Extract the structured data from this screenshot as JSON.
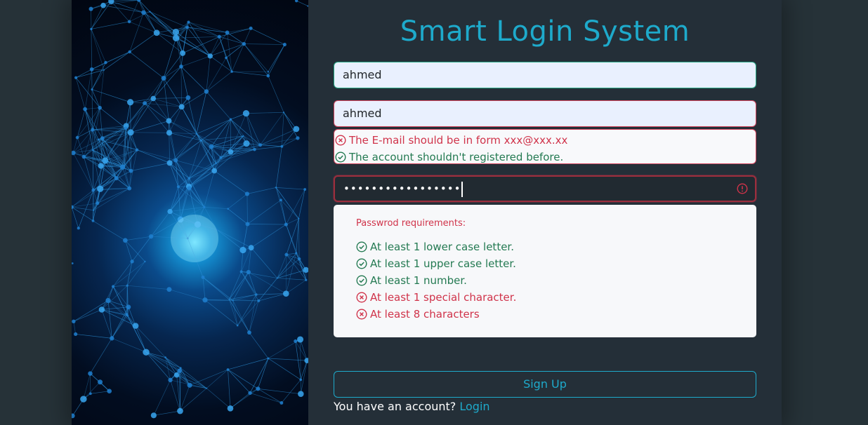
{
  "colors": {
    "accent": "#1eaacb",
    "error": "#d0334a",
    "success": "#247a52",
    "valid_border": "#25a783"
  },
  "title": "Smart Login System",
  "name_field": {
    "value": "ahmed"
  },
  "email_field": {
    "value": "ahmed"
  },
  "email_checks": [
    {
      "text": "The E-mail should be in form xxx@xxx.xx",
      "status": "fail",
      "icon": "x-circle-icon"
    },
    {
      "text": "The account shouldn't registered before.",
      "status": "pass",
      "icon": "check-circle-icon"
    }
  ],
  "password_field": {
    "masked_value": "•••••••••••••••••",
    "status_icon": "alert-circle-icon"
  },
  "password_requirements": {
    "title": "Passwrod requirements:",
    "items": [
      {
        "text": "At least 1 lower case letter.",
        "status": "pass"
      },
      {
        "text": "At least 1 upper case letter.",
        "status": "pass"
      },
      {
        "text": "At least 1 number.",
        "status": "pass"
      },
      {
        "text": "At least 1 special character.",
        "status": "fail"
      },
      {
        "text": "At least 8 characters",
        "status": "fail"
      }
    ]
  },
  "signup_button": {
    "label": "Sign Up"
  },
  "footer": {
    "prompt": "You have an account?",
    "link_label": "Login"
  }
}
